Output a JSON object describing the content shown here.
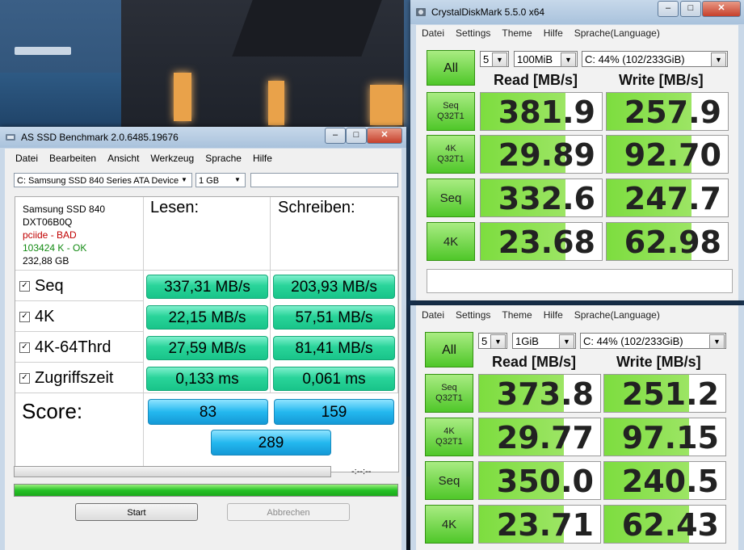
{
  "as_ssd": {
    "title": "AS SSD Benchmark 2.0.6485.19676",
    "menu": [
      "Datei",
      "Bearbeiten",
      "Ansicht",
      "Werkzeug",
      "Sprache",
      "Hilfe"
    ],
    "drive_select": "C: Samsung SSD 840 Series ATA Device",
    "size_select": "1 GB",
    "info": {
      "model": "Samsung SSD 840",
      "firmware": "DXT06B0Q",
      "driver": "pciide - BAD",
      "alignment": "103424 K - OK",
      "capacity": "232,88 GB"
    },
    "col_read": "Lesen:",
    "col_write": "Schreiben:",
    "rows": [
      {
        "label": "Seq",
        "read": "337,31 MB/s",
        "write": "203,93 MB/s"
      },
      {
        "label": "4K",
        "read": "22,15 MB/s",
        "write": "57,51 MB/s"
      },
      {
        "label": "4K-64Thrd",
        "read": "27,59 MB/s",
        "write": "81,41 MB/s"
      },
      {
        "label": "Zugriffszeit",
        "read": "0,133 ms",
        "write": "0,061 ms"
      }
    ],
    "score_label": "Score:",
    "score_read": "83",
    "score_write": "159",
    "score_total": "289",
    "time_display": "-:--:--",
    "overall_progress": 1.0,
    "start_label": "Start",
    "abort_label": "Abbrechen",
    "colors": {
      "result": "#29d49a",
      "score": "#24b8ef"
    }
  },
  "cdm1": {
    "title": "CrystalDiskMark 5.5.0 x64",
    "menu": [
      "Datei",
      "Settings",
      "Theme",
      "Hilfe",
      "Sprache(Language)"
    ],
    "count": "5",
    "size": "100MiB",
    "drive": "C: 44% (102/233GiB)",
    "all_label": "All",
    "read_header": "Read [MB/s]",
    "write_header": "Write [MB/s]",
    "rows": [
      {
        "label1": "Seq",
        "label2": "Q32T1",
        "read": "381.9",
        "write": "257.9"
      },
      {
        "label1": "4K",
        "label2": "Q32T1",
        "read": "29.89",
        "write": "92.70"
      },
      {
        "label1": "Seq",
        "label2": "",
        "read": "332.6",
        "write": "247.7"
      },
      {
        "label1": "4K",
        "label2": "",
        "read": "23.68",
        "write": "62.98"
      }
    ]
  },
  "cdm2": {
    "menu": [
      "Datei",
      "Settings",
      "Theme",
      "Hilfe",
      "Sprache(Language)"
    ],
    "count": "5",
    "size": "1GiB",
    "drive": "C: 44% (102/233GiB)",
    "all_label": "All",
    "read_header": "Read [MB/s]",
    "write_header": "Write [MB/s]",
    "rows": [
      {
        "label1": "Seq",
        "label2": "Q32T1",
        "read": "373.8",
        "write": "251.2"
      },
      {
        "label1": "4K",
        "label2": "Q32T1",
        "read": "29.77",
        "write": "97.15"
      },
      {
        "label1": "Seq",
        "label2": "",
        "read": "350.0",
        "write": "240.5"
      },
      {
        "label1": "4K",
        "label2": "",
        "read": "23.71",
        "write": "62.43"
      }
    ]
  },
  "window_controls": {
    "minimize": "–",
    "maximize": "□",
    "close": "✕"
  }
}
